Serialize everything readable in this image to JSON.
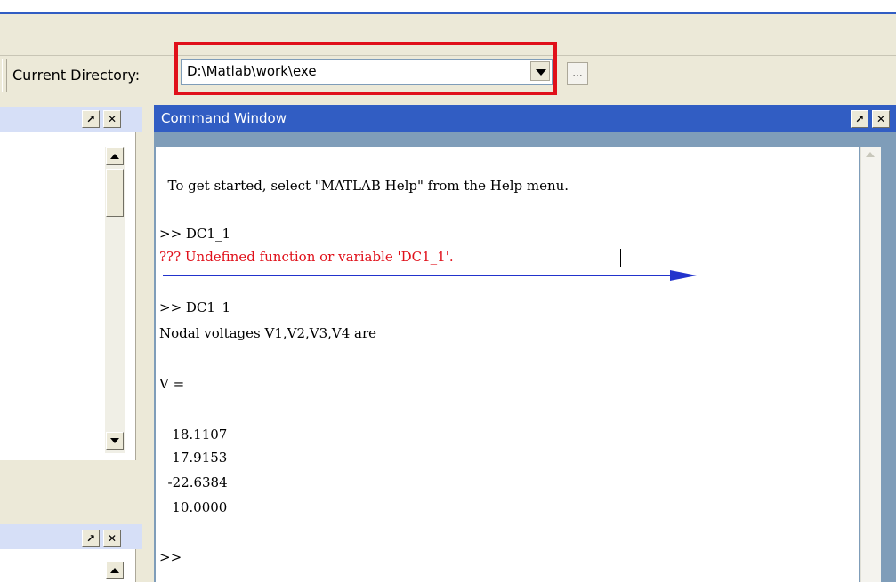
{
  "toolbar": {
    "current_directory_label": "Current Directory:",
    "current_directory_value": "D:\\Matlab\\work\\exe",
    "browse_label": "..."
  },
  "pane_buttons": {
    "undock": "↗",
    "close": "✕"
  },
  "command_window": {
    "title": "Command Window",
    "lines": [
      "  To get started, select \"MATLAB Help\" from the Help menu.",
      ">> DC1_1",
      "??? Undefined function or variable 'DC1_1'.",
      ">> DC1_1",
      "Nodal voltages V1,V2,V3,V4 are",
      "V =",
      "   18.1107",
      "   17.9153",
      "  -22.6384",
      "   10.0000",
      ">>"
    ]
  },
  "colors": {
    "highlight_border": "#e0101a",
    "error_text": "#e0101a",
    "annotation_arrow": "#2233cc",
    "title_bar": "#315dc3"
  }
}
